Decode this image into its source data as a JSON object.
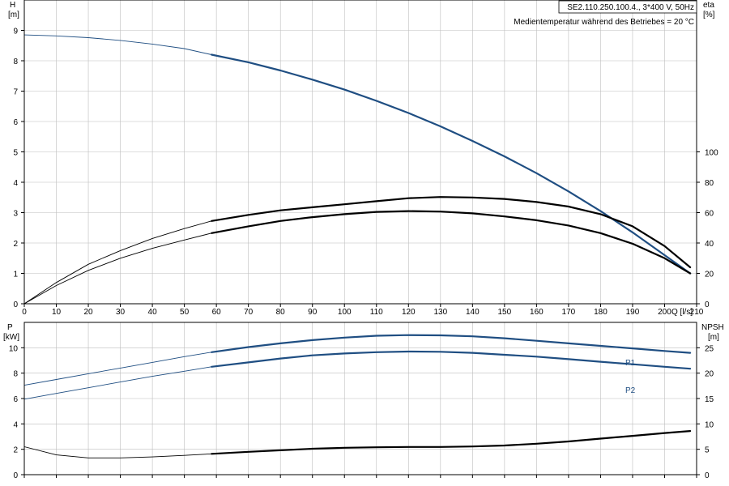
{
  "header": {
    "model": "SE2.110.250.100.4., 3*400 V, 50Hz",
    "medium": "Medientemperatur während des Betriebes = 20 °C"
  },
  "chart_data": [
    {
      "type": "line",
      "panel": "top",
      "xlabel": "Q [l/s]",
      "xlim": [
        0,
        210
      ],
      "xticks": [
        0,
        10,
        20,
        30,
        40,
        50,
        60,
        70,
        80,
        90,
        100,
        110,
        120,
        130,
        140,
        150,
        160,
        170,
        180,
        190,
        200,
        210
      ],
      "ylabel_left_line1": "H",
      "ylabel_left_line2": "[m]",
      "ylim_left": [
        0,
        10
      ],
      "yticks_left": [
        0,
        1,
        2,
        3,
        4,
        5,
        6,
        7,
        8,
        9
      ],
      "ylabel_right_line1": "eta",
      "ylabel_right_line2": "[%]",
      "ylim_right": [
        0,
        200
      ],
      "yticks_right": [
        0,
        20,
        40,
        60,
        80,
        100
      ],
      "grid": true,
      "series": [
        {
          "axis": "left",
          "color": "#1f4e82",
          "operating_range": [
            58.5,
            208
          ],
          "x": [
            0,
            10,
            20,
            30,
            40,
            50,
            58.5,
            70,
            80,
            90,
            100,
            110,
            120,
            130,
            140,
            150,
            160,
            170,
            180,
            190,
            200,
            208
          ],
          "y": [
            8.85,
            8.82,
            8.76,
            8.67,
            8.55,
            8.4,
            8.2,
            7.95,
            7.68,
            7.38,
            7.05,
            6.68,
            6.28,
            5.84,
            5.36,
            4.85,
            4.3,
            3.7,
            3.05,
            2.35,
            1.6,
            1.0
          ]
        },
        {
          "axis": "right",
          "color": "#000000",
          "operating_range": [
            58.5,
            208
          ],
          "x": [
            0,
            10,
            20,
            30,
            40,
            50,
            58.5,
            70,
            80,
            90,
            100,
            110,
            120,
            130,
            140,
            150,
            160,
            170,
            180,
            190,
            200,
            208
          ],
          "y": [
            0,
            14,
            26,
            35,
            43,
            49.5,
            54.5,
            58.5,
            61.5,
            63.5,
            65.5,
            67.5,
            69.5,
            70.3,
            70,
            69,
            67,
            64,
            59,
            51,
            38,
            24
          ]
        },
        {
          "axis": "right",
          "color": "#000000",
          "operating_range": [
            58.5,
            208
          ],
          "x": [
            0,
            10,
            20,
            30,
            40,
            50,
            58.5,
            70,
            80,
            90,
            100,
            110,
            120,
            130,
            140,
            150,
            160,
            170,
            180,
            190,
            200,
            208
          ],
          "y": [
            0,
            12,
            22,
            30,
            36.5,
            42,
            46.5,
            51,
            54.5,
            57,
            59,
            60.5,
            61,
            60.7,
            59.5,
            57.5,
            55,
            51.5,
            46.5,
            39.5,
            30,
            20
          ]
        }
      ]
    },
    {
      "type": "line",
      "panel": "bottom",
      "xlim": [
        0,
        210
      ],
      "ylabel_left_line1": "P",
      "ylabel_left_line2": "[kW]",
      "ylim_left": [
        0,
        12
      ],
      "yticks_left": [
        0,
        2,
        4,
        6,
        8,
        10
      ],
      "ylabel_right_line1": "NPSH",
      "ylabel_right_line2": "[m]",
      "ylim_right": [
        0,
        30
      ],
      "yticks_right": [
        0,
        5,
        10,
        15,
        20,
        25
      ],
      "grid": true,
      "series": [
        {
          "name": "P1",
          "axis": "left",
          "color": "#1f4e82",
          "operating_range": [
            58.5,
            208
          ],
          "x": [
            0,
            10,
            20,
            30,
            40,
            50,
            58.5,
            70,
            80,
            90,
            100,
            110,
            120,
            130,
            140,
            150,
            160,
            170,
            180,
            190,
            200,
            208
          ],
          "y": [
            7.05,
            7.5,
            7.95,
            8.4,
            8.85,
            9.3,
            9.65,
            10.05,
            10.35,
            10.6,
            10.8,
            10.95,
            11.0,
            10.98,
            10.9,
            10.75,
            10.55,
            10.35,
            10.15,
            9.95,
            9.75,
            9.6
          ]
        },
        {
          "name": "P2",
          "axis": "left",
          "color": "#1f4e82",
          "operating_range": [
            58.5,
            208
          ],
          "x": [
            0,
            10,
            20,
            30,
            40,
            50,
            58.5,
            70,
            80,
            90,
            100,
            110,
            120,
            130,
            140,
            150,
            160,
            170,
            180,
            190,
            200,
            208
          ],
          "y": [
            5.95,
            6.4,
            6.85,
            7.3,
            7.75,
            8.15,
            8.5,
            8.85,
            9.15,
            9.4,
            9.55,
            9.65,
            9.7,
            9.68,
            9.6,
            9.45,
            9.3,
            9.1,
            8.9,
            8.7,
            8.5,
            8.35
          ]
        },
        {
          "axis": "right",
          "color": "#000000",
          "operating_range": [
            58.5,
            208
          ],
          "x": [
            0,
            10,
            20,
            30,
            40,
            50,
            58.5,
            70,
            80,
            90,
            100,
            110,
            120,
            130,
            140,
            150,
            160,
            170,
            180,
            190,
            200,
            208
          ],
          "y": [
            5.5,
            3.9,
            3.3,
            3.3,
            3.5,
            3.8,
            4.1,
            4.5,
            4.8,
            5.1,
            5.3,
            5.4,
            5.45,
            5.45,
            5.55,
            5.75,
            6.1,
            6.55,
            7.1,
            7.65,
            8.2,
            8.6
          ]
        }
      ]
    }
  ]
}
